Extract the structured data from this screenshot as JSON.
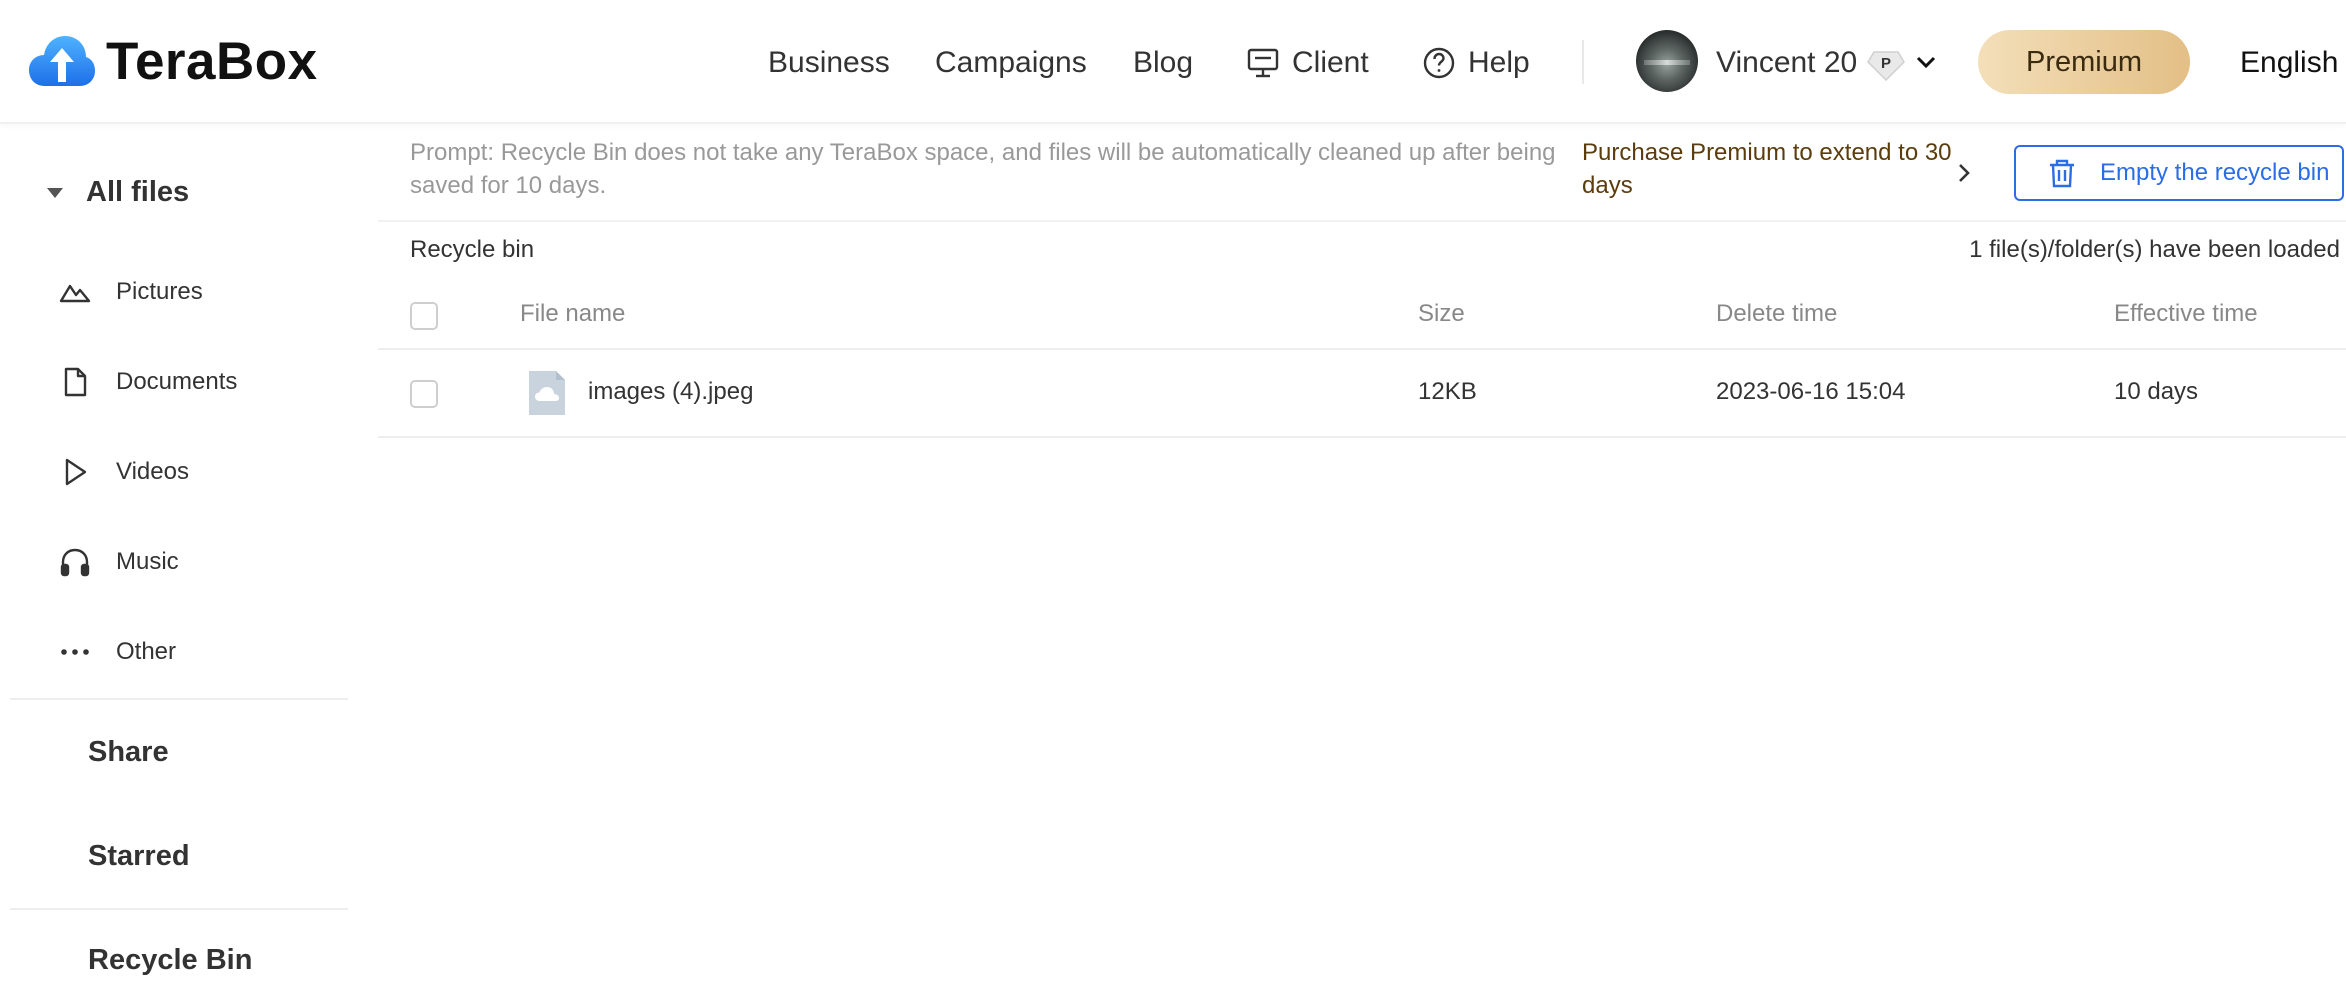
{
  "app": {
    "brand": "TeraBox"
  },
  "header": {
    "nav": {
      "business": "Business",
      "campaigns": "Campaigns",
      "blog": "Blog",
      "client": "Client",
      "help": "Help"
    },
    "user": {
      "name": "Vincent 20",
      "badge_letter": "P"
    },
    "premium_label": "Premium",
    "language": "English"
  },
  "sidebar": {
    "all_files": "All files",
    "categories": {
      "pictures": "Pictures",
      "documents": "Documents",
      "videos": "Videos",
      "music": "Music",
      "other": "Other"
    },
    "share": "Share",
    "starred": "Starred",
    "recycle_bin": "Recycle Bin"
  },
  "notice": {
    "text": "Prompt: Recycle Bin does not take any TeraBox space, and files will be automatically cleaned up after being saved for 10 days.",
    "upgrade_link": "Purchase Premium to extend to 30 days",
    "empty_button": "Empty the recycle bin"
  },
  "main": {
    "breadcrumb": "Recycle bin",
    "loaded_status": "1 file(s)/folder(s) have been loaded",
    "columns": {
      "name": "File name",
      "size": "Size",
      "delete_time": "Delete time",
      "effective_time": "Effective time"
    },
    "rows": [
      {
        "name": "images (4).jpeg",
        "size": "12KB",
        "delete_time": "2023-06-16 15:04",
        "effective_time": "10 days"
      }
    ]
  },
  "colors": {
    "accent_blue": "#2b6de5",
    "premium_gold": "#e3bf86",
    "upgrade_text": "#5b3c0c"
  },
  "icons": {
    "logo": "cloud-upload-icon",
    "client": "monitor-icon",
    "help": "question-circle-icon",
    "pictures": "mountain-icon",
    "documents": "document-icon",
    "videos": "play-icon",
    "music": "headphones-icon",
    "other": "more-dots-icon",
    "empty": "trash-icon",
    "file": "image-file-icon"
  }
}
